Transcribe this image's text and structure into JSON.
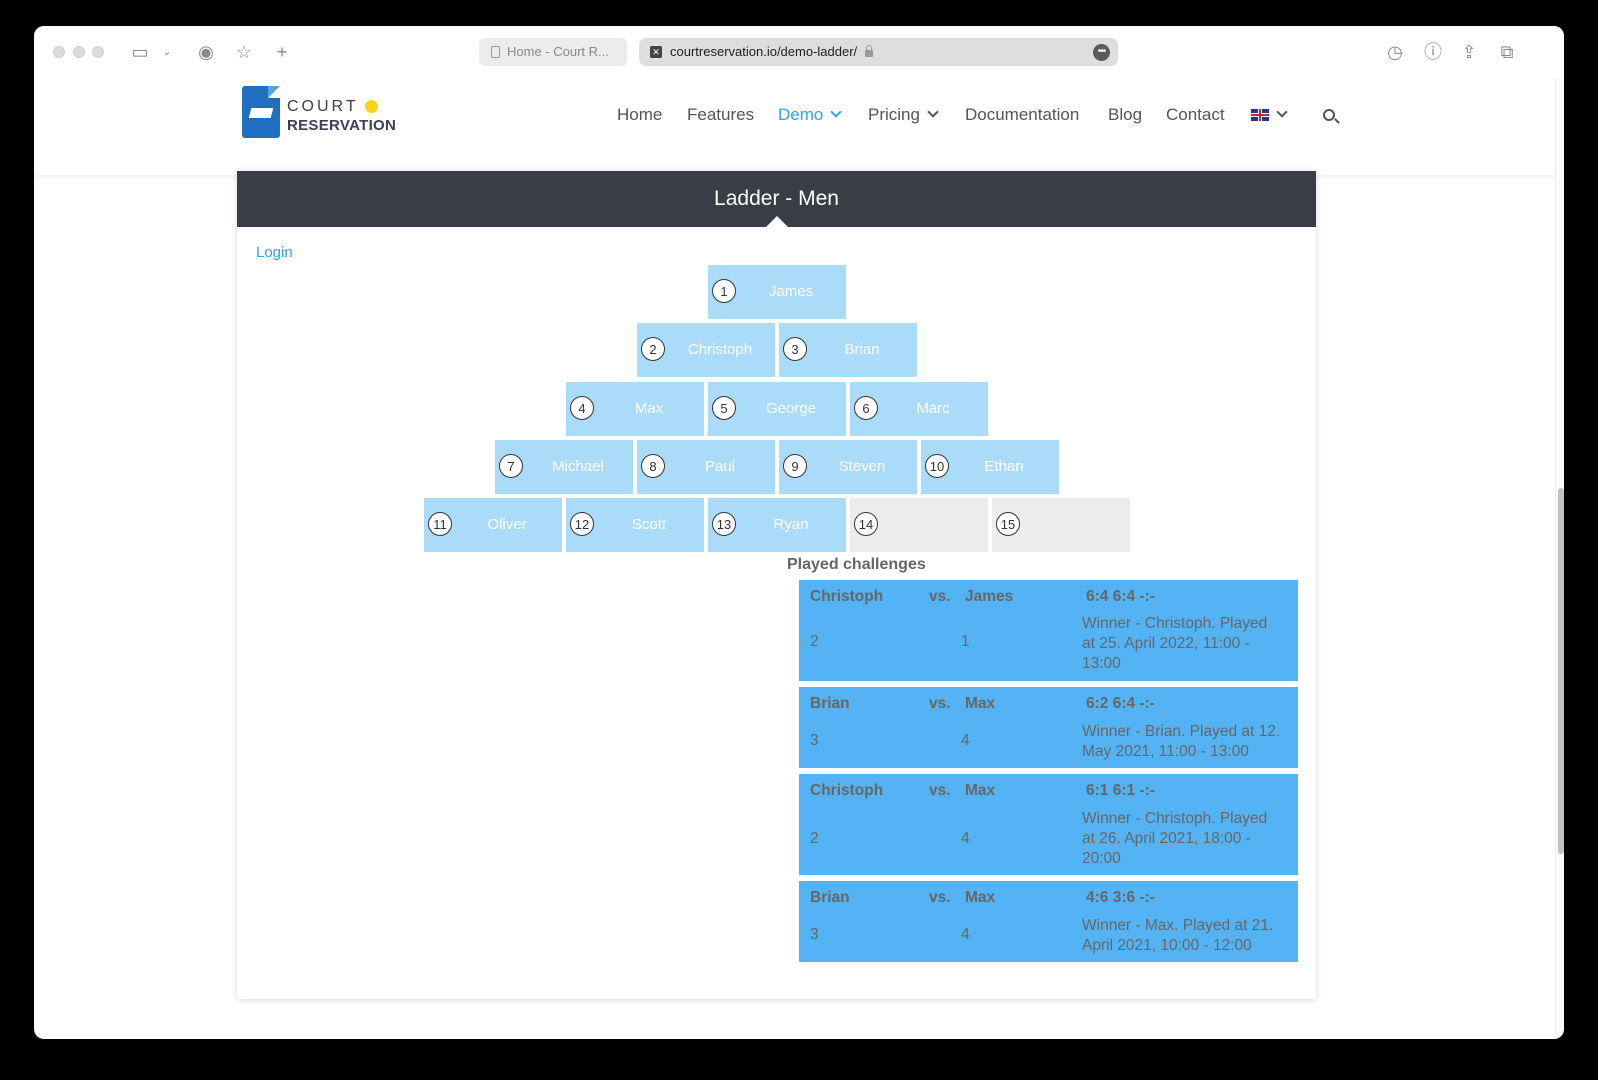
{
  "browser": {
    "tab_inactive_title": "Home - Court R...",
    "url": "courtreservation.io/demo-ladder/",
    "url_more": "•••"
  },
  "site": {
    "logo_line1": "COURT",
    "logo_line2": "RESERVATION",
    "nav": {
      "home": "Home",
      "features": "Features",
      "demo": "Demo",
      "pricing": "Pricing",
      "documentation": "Documentation",
      "blog": "Blog",
      "contact": "Contact"
    }
  },
  "ladder": {
    "title": "Ladder - Men",
    "login": "Login",
    "players": [
      {
        "rank": "1",
        "name": "James"
      },
      {
        "rank": "2",
        "name": "Christoph"
      },
      {
        "rank": "3",
        "name": "Brian"
      },
      {
        "rank": "4",
        "name": "Max"
      },
      {
        "rank": "5",
        "name": "George"
      },
      {
        "rank": "6",
        "name": "Marc"
      },
      {
        "rank": "7",
        "name": "Michael"
      },
      {
        "rank": "8",
        "name": "Paul"
      },
      {
        "rank": "9",
        "name": "Steven"
      },
      {
        "rank": "10",
        "name": "Ethan"
      },
      {
        "rank": "11",
        "name": "Oliver"
      },
      {
        "rank": "12",
        "name": "Scott"
      },
      {
        "rank": "13",
        "name": "Ryan"
      },
      {
        "rank": "14",
        "name": ""
      },
      {
        "rank": "15",
        "name": ""
      }
    ]
  },
  "challenges": {
    "title": "Played challenges",
    "vs_label": "vs.",
    "items": [
      {
        "player1": "Christoph",
        "player2": "James",
        "score": "6:4 6:4 -:-",
        "rank1": "2",
        "rank2": "1",
        "info": "Winner - Christoph. Played at 25. April 2022, 11:00 - 13:00"
      },
      {
        "player1": "Brian",
        "player2": "Max",
        "score": "6:2 6:4 -:-",
        "rank1": "3",
        "rank2": "4",
        "info": "Winner - Brian. Played at 12. May 2021, 11:00 - 13:00"
      },
      {
        "player1": "Christoph",
        "player2": "Max",
        "score": "6:1 6:1 -:-",
        "rank1": "2",
        "rank2": "4",
        "info": "Winner - Christoph. Played at 26. April 2021, 18:00 - 20:00"
      },
      {
        "player1": "Brian",
        "player2": "Max",
        "score": "4:6 3:6 -:-",
        "rank1": "3",
        "rank2": "4",
        "info": "Winner - Max. Played at 21. April 2021, 10:00 - 12:00"
      }
    ]
  },
  "colors": {
    "accent": "#2ea3f2",
    "header_dark": "#393e46",
    "ladder_cell": "#aadcfa",
    "ladder_empty": "#ececec",
    "challenge_bg": "#53b3f5"
  }
}
